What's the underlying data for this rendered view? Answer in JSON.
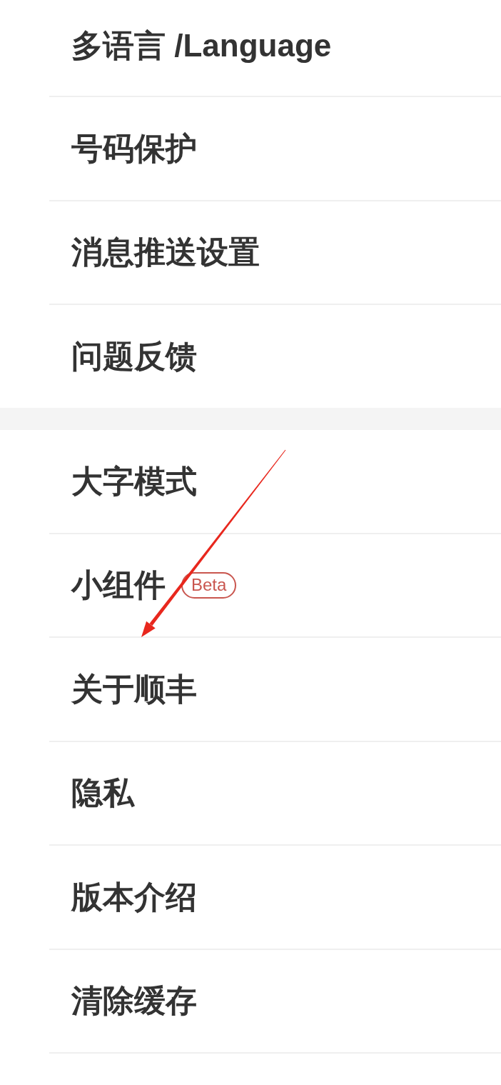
{
  "sections": [
    {
      "items": [
        {
          "label": "多语言 /Language"
        },
        {
          "label": "号码保护"
        },
        {
          "label": "消息推送设置"
        },
        {
          "label": "问题反馈"
        }
      ]
    },
    {
      "items": [
        {
          "label": "大字模式"
        },
        {
          "label": "小组件",
          "badge": "Beta"
        },
        {
          "label": "关于顺丰"
        },
        {
          "label": "隐私"
        },
        {
          "label": "版本介绍"
        },
        {
          "label": "清除缓存"
        }
      ]
    }
  ],
  "annotations": [
    {
      "kind": "arrow"
    }
  ]
}
